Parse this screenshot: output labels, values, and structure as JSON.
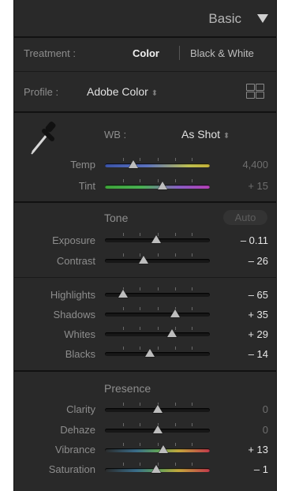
{
  "panel": {
    "title": "Basic",
    "treatment": {
      "label": "Treatment :",
      "options": [
        "Color",
        "Black & White"
      ],
      "selected": "Color"
    },
    "profile": {
      "label": "Profile :",
      "value": "Adobe Color",
      "arrow": "⬍"
    },
    "wb": {
      "label": "WB :",
      "value": "As Shot",
      "arrow": "⬍"
    },
    "tone_title": "Tone",
    "auto_label": "Auto",
    "presence_title": "Presence",
    "sliders": {
      "temp": {
        "label": "Temp",
        "value": "4,400",
        "fraction": 0.27
      },
      "tint": {
        "label": "Tint",
        "value": "+ 15",
        "fraction": 0.55
      },
      "exposure": {
        "label": "Exposure",
        "value": "– 0.11",
        "fraction": 0.49
      },
      "contrast": {
        "label": "Contrast",
        "value": "– 26",
        "fraction": 0.37
      },
      "highlights": {
        "label": "Highlights",
        "value": "– 65",
        "fraction": 0.17
      },
      "shadows": {
        "label": "Shadows",
        "value": "+ 35",
        "fraction": 0.67
      },
      "whites": {
        "label": "Whites",
        "value": "+ 29",
        "fraction": 0.64
      },
      "blacks": {
        "label": "Blacks",
        "value": "– 14",
        "fraction": 0.43
      },
      "clarity": {
        "label": "Clarity",
        "value": "0",
        "fraction": 0.5
      },
      "dehaze": {
        "label": "Dehaze",
        "value": "0",
        "fraction": 0.5
      },
      "vibrance": {
        "label": "Vibrance",
        "value": "+ 13",
        "fraction": 0.56
      },
      "saturation": {
        "label": "Saturation",
        "value": "– 1",
        "fraction": 0.49
      }
    }
  },
  "colors": {
    "panel_bg": "#292929",
    "track": "#171717",
    "thumb": "#bdbdbd"
  }
}
